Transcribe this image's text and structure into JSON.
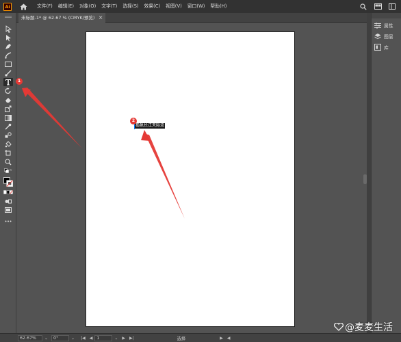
{
  "app": {
    "logo_text": "Ai"
  },
  "menu": {
    "items": [
      "文件(F)",
      "编辑(E)",
      "对象(O)",
      "文字(T)",
      "选择(S)",
      "效果(C)",
      "视图(V)",
      "窗口(W)",
      "帮助(H)"
    ]
  },
  "document_tab": {
    "title": "未标题-1* @ 62.67 % (CMYK/预览)",
    "close_glyph": "×"
  },
  "canvas": {
    "text_object": "孤帆长江天际流"
  },
  "annotations": {
    "marker_1": "1",
    "marker_2": "2",
    "arrow_color": "#e53935"
  },
  "right_panel": {
    "items": [
      {
        "label": "属性",
        "icon": "properties-icon"
      },
      {
        "label": "图层",
        "icon": "layers-icon"
      },
      {
        "label": "库",
        "icon": "libraries-icon"
      }
    ]
  },
  "status_bar": {
    "zoom": "62.67%",
    "rotation": "0°",
    "artboard_number": "1",
    "tool_status": "选择"
  },
  "watermark": {
    "text": "@麦麦生活"
  }
}
